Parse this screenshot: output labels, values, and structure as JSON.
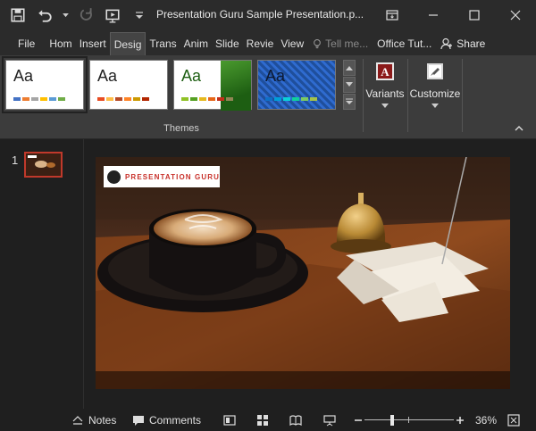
{
  "window": {
    "title": "Presentation Guru Sample Presentation.p..."
  },
  "tabs": [
    {
      "label": "File"
    },
    {
      "label": "Hom"
    },
    {
      "label": "Insert"
    },
    {
      "label": "Desig"
    },
    {
      "label": "Trans"
    },
    {
      "label": "Anim"
    },
    {
      "label": "Slide"
    },
    {
      "label": "Revie"
    },
    {
      "label": "View"
    }
  ],
  "tell_me": {
    "placeholder": "Tell me..."
  },
  "account": {
    "label": "Office Tut..."
  },
  "share": {
    "label": "Share"
  },
  "ribbon": {
    "themes": [
      {
        "label": "Aa",
        "selected": true
      },
      {
        "label": "Aa",
        "selected": false
      },
      {
        "label": "Aa",
        "selected": false
      },
      {
        "label": "Aa",
        "selected": false
      }
    ],
    "variants_label": "Variants",
    "customize_label": "Customize",
    "group_name": "Themes"
  },
  "slides": {
    "current_number": "1"
  },
  "slide_content": {
    "logo_text": "PRESENTATION GURU"
  },
  "statusbar": {
    "notes_label": "Notes",
    "comments_label": "Comments",
    "zoom": "36%",
    "zoom_level_fraction": 0.3
  },
  "colors": {
    "accent_selected_thumb": "#c0392b",
    "logo_red": "#c8302a"
  }
}
